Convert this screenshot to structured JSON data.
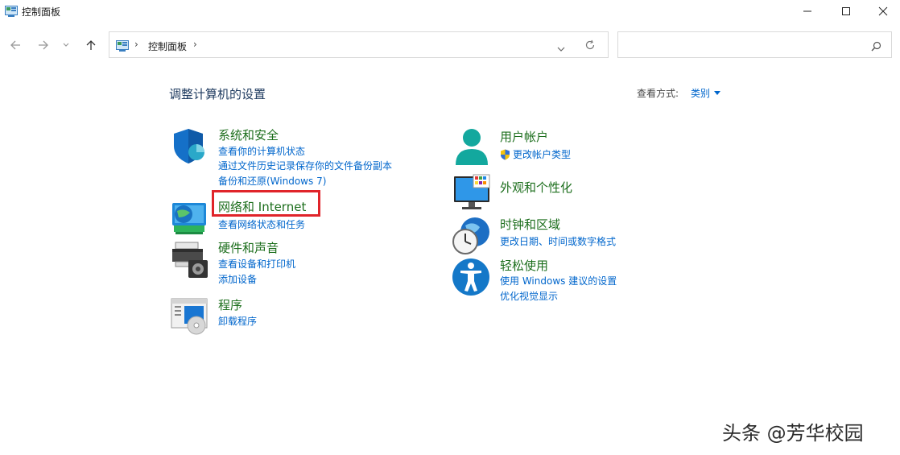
{
  "window": {
    "title": "控制面板",
    "controls": {
      "minimize": "minimize-icon",
      "maximize": "maximize-icon",
      "close": "close-icon"
    }
  },
  "navigation": {
    "back": "back-arrow-icon",
    "forward": "forward-arrow-icon",
    "recent": "chevron-down-icon",
    "up": "up-arrow-icon",
    "address": {
      "breadcrumb": "控制面板",
      "separator": "›"
    },
    "search": {
      "value": "",
      "placeholder": ""
    }
  },
  "main": {
    "heading": "调整计算机的设置",
    "view_by_label": "查看方式:",
    "view_by_value": "类别",
    "categories": [
      {
        "title": "系统和安全",
        "icon": "shield-icon",
        "links": [
          "查看你的计算机状态",
          "通过文件历史记录保存你的文件备份副本",
          "备份和还原(Windows 7)"
        ]
      },
      {
        "title": "网络和 Internet",
        "icon": "network-globe-icon",
        "links": [
          "查看网络状态和任务"
        ]
      },
      {
        "title": "硬件和声音",
        "icon": "printer-speaker-icon",
        "links": [
          "查看设备和打印机",
          "添加设备"
        ]
      },
      {
        "title": "程序",
        "icon": "programs-disc-icon",
        "links": [
          "卸载程序"
        ]
      },
      {
        "title": "用户帐户",
        "icon": "user-icon",
        "links": [
          "更改帐户类型"
        ]
      },
      {
        "title": "外观和个性化",
        "icon": "monitor-palette-icon",
        "links": []
      },
      {
        "title": "时钟和区域",
        "icon": "clock-globe-icon",
        "links": [
          "更改日期、时间或数字格式"
        ]
      },
      {
        "title": "轻松使用",
        "icon": "accessibility-icon",
        "links": [
          "使用 Windows 建议的设置",
          "优化视觉显示"
        ]
      }
    ]
  },
  "watermark": "头条 @芳华校园",
  "colors": {
    "category_title": "#1c6e1c",
    "link": "#0066cc",
    "heading": "#1e3a5f",
    "highlight": "#e0242a"
  }
}
